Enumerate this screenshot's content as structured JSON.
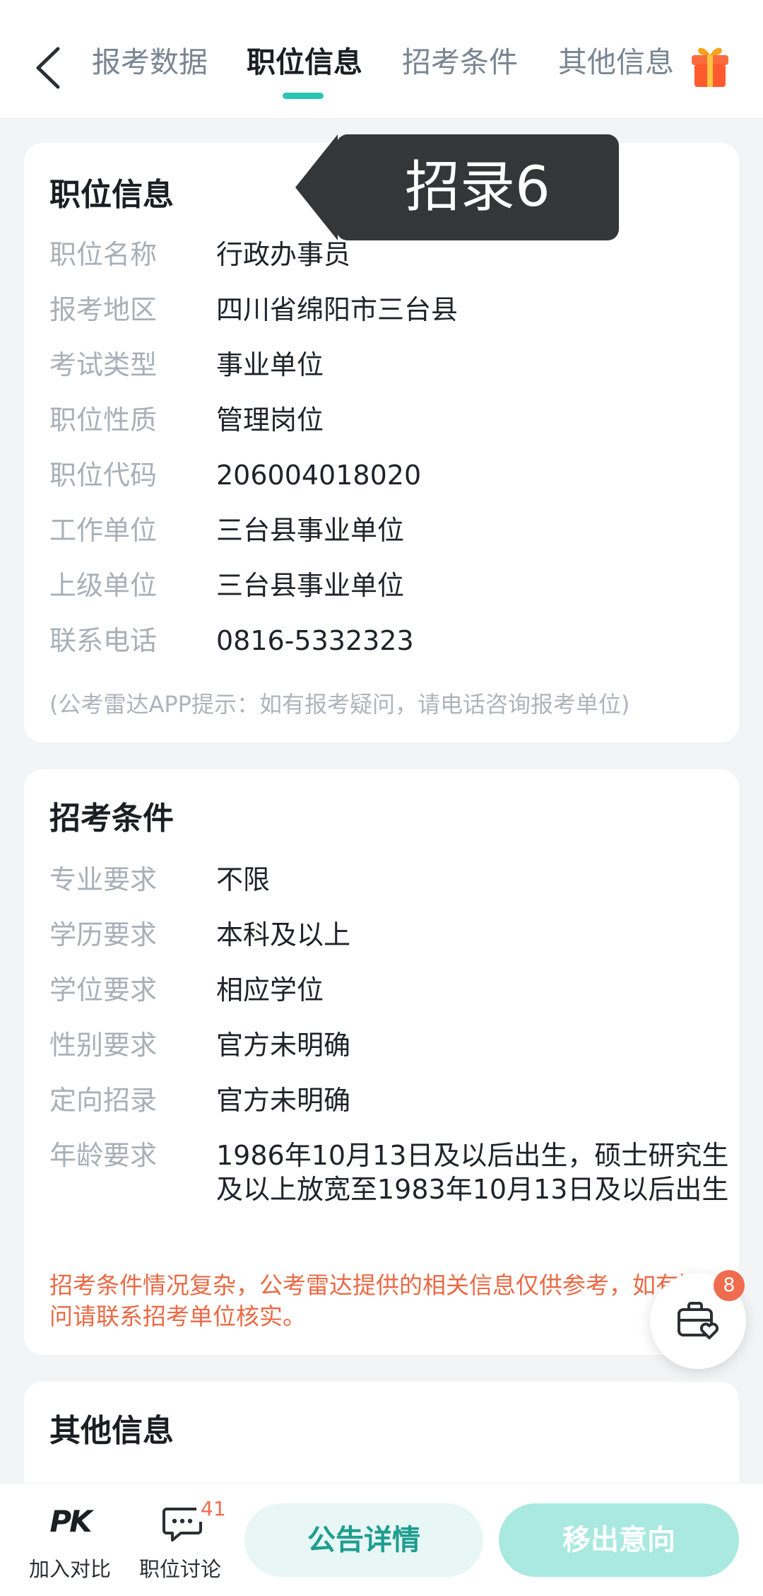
{
  "header": {
    "tabs": [
      {
        "label": "报考数据"
      },
      {
        "label": "职位信息"
      },
      {
        "label": "招考条件"
      },
      {
        "label": "其他信息"
      }
    ],
    "active_tab": "职位信息"
  },
  "toast": {
    "text": "招录6"
  },
  "position_info": {
    "title": "职位信息",
    "rows": [
      {
        "label": "职位名称",
        "value": "行政办事员"
      },
      {
        "label": "报考地区",
        "value": "四川省绵阳市三台县"
      },
      {
        "label": "考试类型",
        "value": "事业单位"
      },
      {
        "label": "职位性质",
        "value": "管理岗位"
      },
      {
        "label": "职位代码",
        "value": "206004018020"
      },
      {
        "label": "工作单位",
        "value": "三台县事业单位"
      },
      {
        "label": "上级单位",
        "value": "三台县事业单位"
      },
      {
        "label": "联系电话",
        "value": "0816-5332323"
      }
    ],
    "note": "(公考雷达APP提示：如有报考疑问，请电话咨询报考单位)"
  },
  "conditions": {
    "title": "招考条件",
    "rows": [
      {
        "label": "专业要求",
        "value": "不限"
      },
      {
        "label": "学历要求",
        "value": "本科及以上"
      },
      {
        "label": "学位要求",
        "value": "相应学位"
      },
      {
        "label": "性别要求",
        "value": "官方未明确"
      },
      {
        "label": "定向招录",
        "value": "官方未明确"
      },
      {
        "label": "年龄要求",
        "value": "1986年10月13日及以后出生，硕士研究生及以上放宽至1983年10月13日及以后出生"
      }
    ],
    "warning": "招考条件情况复杂，公考雷达提供的相关信息仅供参考，如有疑问请联系招考单位核实。"
  },
  "other_info": {
    "title": "其他信息"
  },
  "favorites": {
    "badge": "8"
  },
  "bottom_bar": {
    "compare_label": "加入对比",
    "compare_icon_text": "PK",
    "discuss_label": "职位讨论",
    "discuss_badge": "41",
    "notice_button": "公告详情",
    "remove_button": "移出意向"
  },
  "colors": {
    "accent": "#2cc4b2",
    "warning": "#ea6a45",
    "badge": "#f06c4f"
  }
}
